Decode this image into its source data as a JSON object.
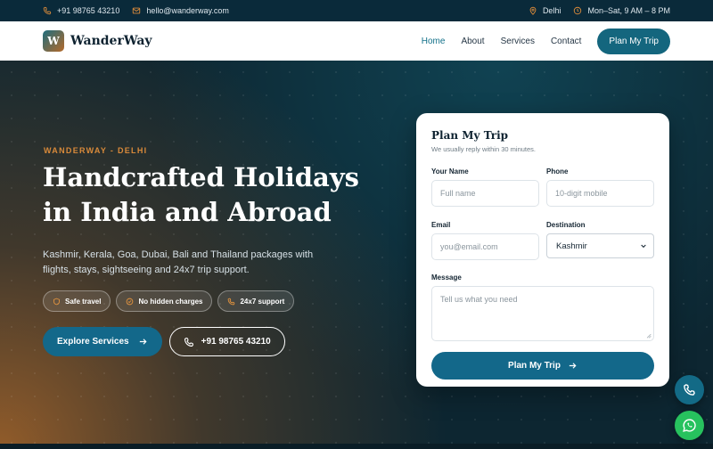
{
  "topbar": {
    "phone": "+91 98765 43210",
    "email": "hello@wanderway.com",
    "location": "Delhi",
    "hours": "Mon–Sat, 9 AM – 8 PM"
  },
  "header": {
    "logo_letter": "W",
    "brand": "WanderWay",
    "nav": [
      "Home",
      "About",
      "Services",
      "Contact"
    ],
    "cta": "Plan My Trip"
  },
  "hero": {
    "eyebrow": "WANDERWAY - DELHI",
    "headline": "Handcrafted Holidays in India and Abroad",
    "subtext": "Kashmir, Kerala, Goa, Dubai, Bali and Thailand packages with flights, stays, sightseeing and 24x7 trip support.",
    "chips": [
      "Safe travel",
      "No hidden charges",
      "24x7 support"
    ],
    "primary_button": "Explore Services",
    "phone_button": "+91 98765 43210"
  },
  "form": {
    "title": "Plan My Trip",
    "subtitle": "We usually reply within 30 minutes.",
    "name_label": "Your Name",
    "name_placeholder": "Full name",
    "phone_label": "Phone",
    "phone_placeholder": "10-digit mobile",
    "email_label": "Email",
    "email_placeholder": "you@email.com",
    "destination_label": "Destination",
    "destination_value": "Kashmir",
    "message_label": "Message",
    "message_placeholder": "Tell us what you need",
    "submit": "Plan My Trip"
  },
  "colors": {
    "accent": "#13688a",
    "orange": "#d98a3a",
    "whatsapp": "#27c25e"
  }
}
